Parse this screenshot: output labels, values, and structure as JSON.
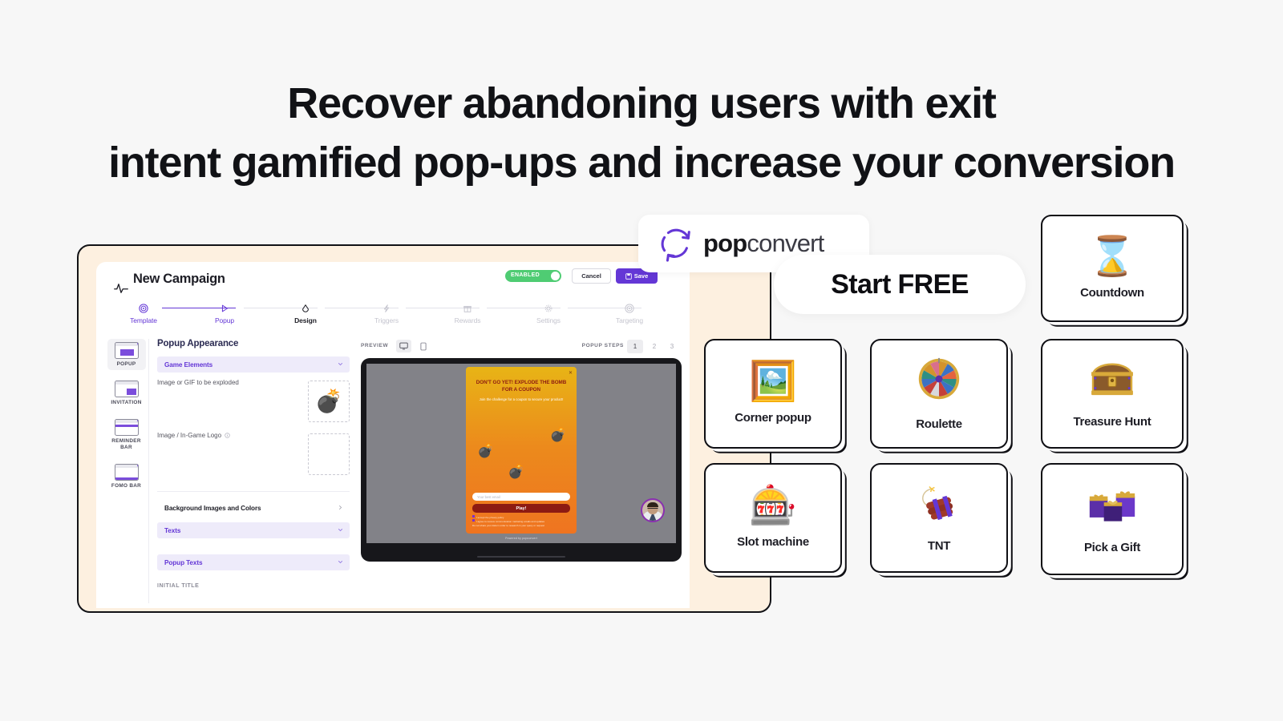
{
  "headline": {
    "line1": "Recover abandoning users with exit",
    "line2": "intent gamified pop-ups and increase your conversion"
  },
  "brand": {
    "logo_bold": "pop",
    "logo_light": "convert",
    "logo_icon": "circular-arrows-icon",
    "accent": "#6437d6"
  },
  "cta": {
    "start_free": "Start FREE"
  },
  "editor": {
    "title": "New Campaign",
    "title_icon": "pulse-icon",
    "toggle": {
      "label": "ENABLED",
      "on": true,
      "color": "#4fcc73"
    },
    "cancel_label": "Cancel",
    "save_label": "Save",
    "steps": [
      {
        "label": "Template",
        "state": "done",
        "icon": "target-icon"
      },
      {
        "label": "Popup",
        "state": "done",
        "icon": "play-icon"
      },
      {
        "label": "Design",
        "state": "current",
        "icon": "drop-icon"
      },
      {
        "label": "Triggers",
        "state": "todo",
        "icon": "bolt-icon"
      },
      {
        "label": "Rewards",
        "state": "todo",
        "icon": "gift-icon"
      },
      {
        "label": "Settings",
        "state": "todo",
        "icon": "gear-icon"
      },
      {
        "label": "Targeting",
        "state": "todo",
        "icon": "target-icon"
      }
    ],
    "sidebar": [
      {
        "label": "POPUP",
        "active": true,
        "dot": "active"
      },
      {
        "label": "INVITATION",
        "active": false,
        "dot": "muted"
      },
      {
        "label": "REMINDER BAR",
        "active": false,
        "dot": "active"
      },
      {
        "label": "FOMO BAR",
        "active": false,
        "dot": "active"
      }
    ],
    "form": {
      "heading": "Popup Appearance",
      "accordion_game": "Game Elements",
      "field_explode": "Image or GIF to be exploded",
      "field_logo": "Image / In-Game Logo",
      "accordion_bg": "Background Images and Colors",
      "accordion_texts": "Texts",
      "accordion_popup_texts": "Popup Texts",
      "initial_title_label": "INITIAL TITLE",
      "explode_asset": "bomb-emoji"
    },
    "preview": {
      "label": "PREVIEW",
      "desktop_icon": "monitor-icon",
      "mobile_icon": "phone-icon",
      "selected_device": "desktop",
      "steps_label": "POPUP STEPS",
      "steps": [
        "1",
        "2",
        "3"
      ],
      "selected_step": "1"
    },
    "popup": {
      "title": "DON'T GO YET! EXPLODE THE BOMB FOR A COUPON",
      "subtitle": "Join the challenge for a coupon to secure your product!",
      "email_placeholder": "Your best email",
      "play_label": "Play!",
      "consent_1": "I accept the privacy policy",
      "consent_2": "I agree to receive communication marketing emails and updates",
      "consent_3": "Do not share your data in order to research in your query or request",
      "powered_by": "Powered by popconvert",
      "close_icon": "close-icon",
      "bomb_icon": "bomb-emoji"
    }
  },
  "game_cards": [
    {
      "name": "Countdown",
      "icon": "hourglass-emoji",
      "glyph": "⌛"
    },
    {
      "name": "Corner popup",
      "icon": "window-frame-icon",
      "glyph": "🖼"
    },
    {
      "name": "Roulette",
      "icon": "roulette-wheel-icon",
      "glyph": "☉"
    },
    {
      "name": "Treasure Hunt",
      "icon": "treasure-chest-icon",
      "glyph": "👜"
    },
    {
      "name": "Slot machine",
      "icon": "slot-machine-emoji",
      "glyph": "🎰"
    },
    {
      "name": "TNT",
      "icon": "dynamite-icon",
      "glyph": "🧨"
    },
    {
      "name": "Pick a Gift",
      "icon": "gift-boxes-icon",
      "glyph": "🎁"
    }
  ]
}
